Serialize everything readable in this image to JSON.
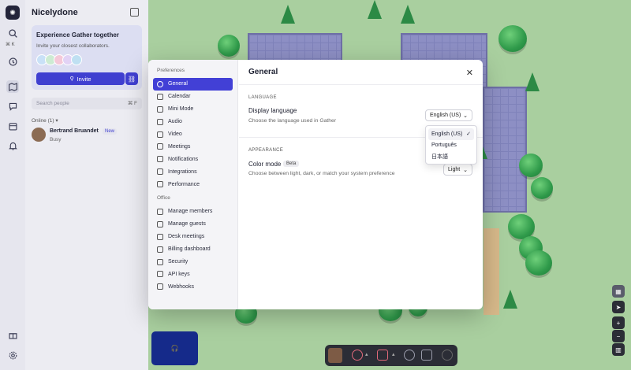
{
  "app": {
    "space_name": "Nicelydone"
  },
  "rail": {
    "search_shortcut": "⌘ K"
  },
  "invite_card": {
    "title": "Experience Gather together",
    "subtitle": "Invite your closest collaborators.",
    "invite_label": "Invite"
  },
  "people": {
    "search_placeholder": "Search people",
    "search_shortcut": "⌘ F",
    "online_label": "Online (1)",
    "users": [
      {
        "name": "Bertrand Bruandet",
        "badge": "New",
        "status": "Busy"
      }
    ]
  },
  "modal": {
    "title": "General",
    "nav": {
      "preferences_heading": "Preferences",
      "preferences": [
        {
          "label": "General",
          "icon": "gear-icon",
          "active": true
        },
        {
          "label": "Calendar",
          "icon": "calendar-icon"
        },
        {
          "label": "Mini Mode",
          "icon": "mini-mode-icon"
        },
        {
          "label": "Audio",
          "icon": "microphone-icon"
        },
        {
          "label": "Video",
          "icon": "camera-icon"
        },
        {
          "label": "Meetings",
          "icon": "meetings-icon"
        },
        {
          "label": "Notifications",
          "icon": "bell-icon"
        },
        {
          "label": "Integrations",
          "icon": "integrations-icon"
        },
        {
          "label": "Performance",
          "icon": "bolt-icon"
        }
      ],
      "office_heading": "Office",
      "office": [
        {
          "label": "Manage members",
          "icon": "members-icon"
        },
        {
          "label": "Manage guests",
          "icon": "guests-icon"
        },
        {
          "label": "Desk meetings",
          "icon": "desk-icon"
        },
        {
          "label": "Billing dashboard",
          "icon": "billing-icon"
        },
        {
          "label": "Security",
          "icon": "lock-icon"
        },
        {
          "label": "API keys",
          "icon": "key-icon"
        },
        {
          "label": "Webhooks",
          "icon": "webhook-icon"
        }
      ]
    },
    "language": {
      "section_label": "LANGUAGE",
      "title": "Display language",
      "subtitle": "Choose the language used in Gather",
      "selected": "English (US)",
      "options": [
        "English (US)",
        "Português",
        "日本語"
      ]
    },
    "appearance": {
      "section_label": "APPEARANCE",
      "title": "Color mode",
      "badge": "Beta",
      "subtitle": "Choose between light, dark, or match your system preference",
      "selected": "Light"
    }
  },
  "colors": {
    "accent": "#4240d6",
    "map_grass": "#a9cf9f",
    "room_floor": "#8d8fc4"
  }
}
